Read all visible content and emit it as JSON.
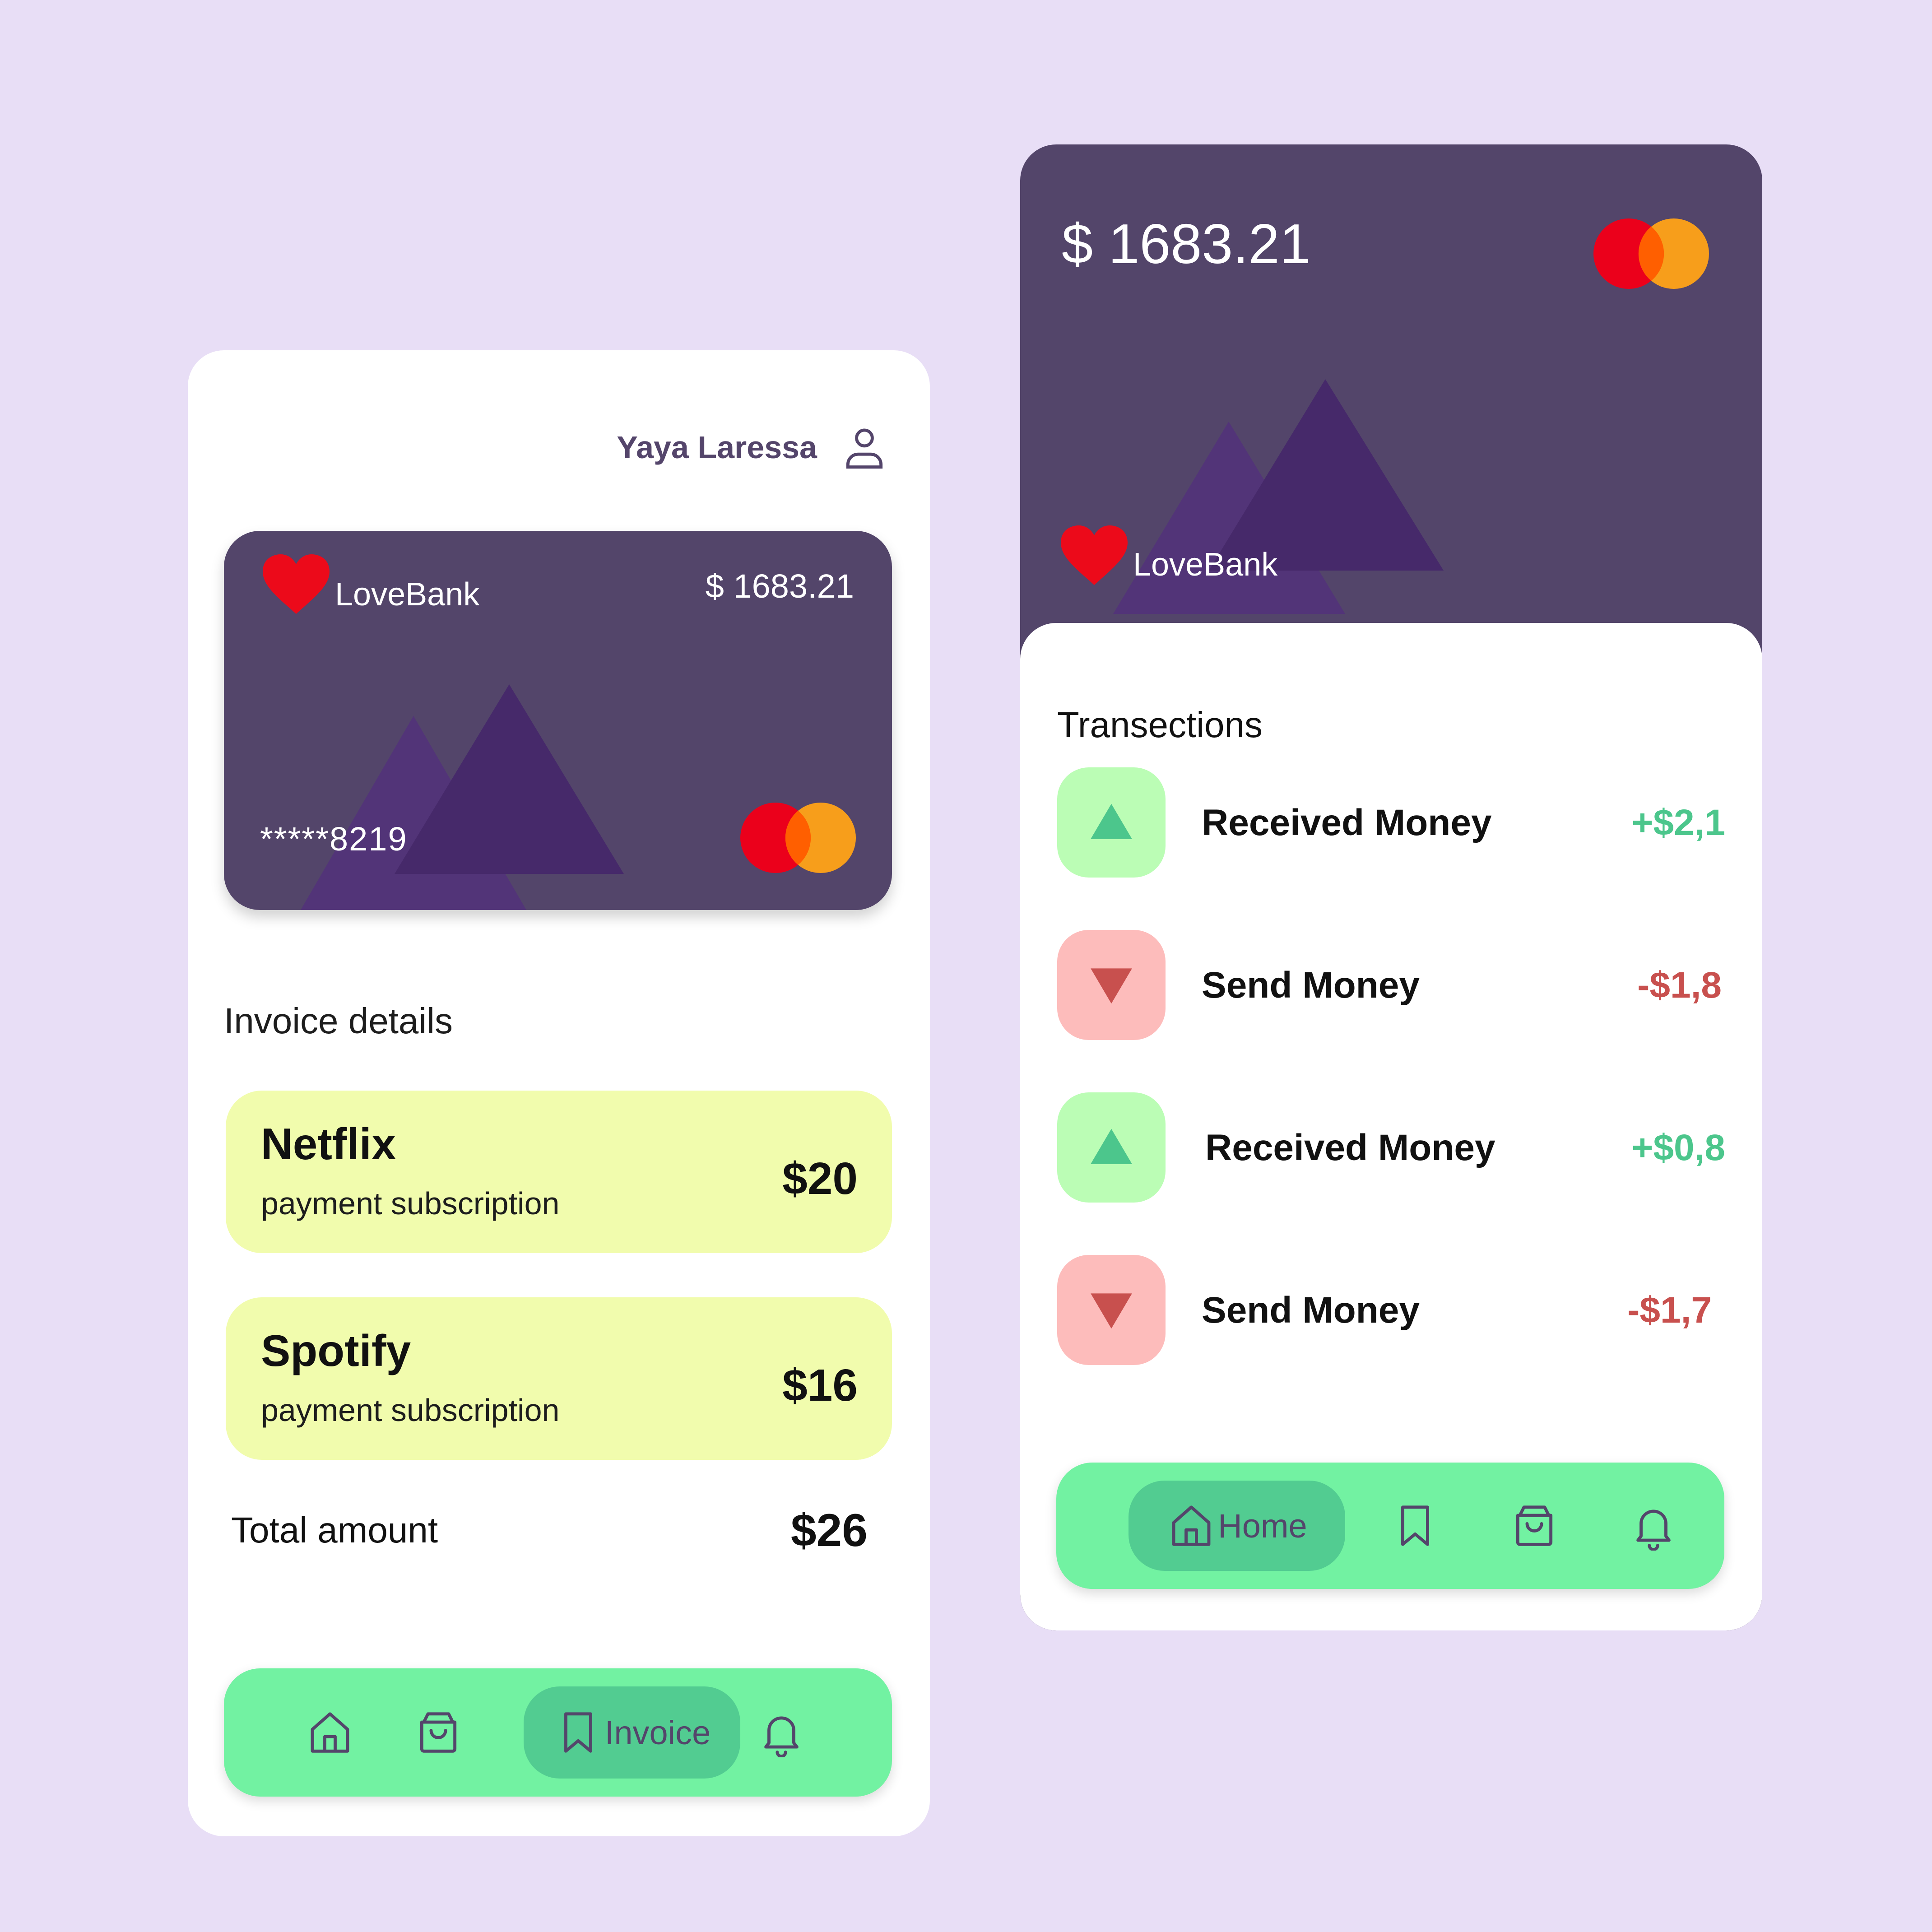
{
  "colors": {
    "background": "#e8def6",
    "card": "#53456a",
    "accent_green": "#72f2a2",
    "active_green": "#52cc91",
    "invoice_bg": "#f1fcad",
    "positive": "#4cc68c",
    "negative": "#c8504e"
  },
  "left": {
    "user_name": "Yaya Laressa",
    "user_icon": "user-icon",
    "card": {
      "brand": "LoveBank",
      "balance": "$ 1683.21",
      "number": "*****8219"
    },
    "invoice_title": "Invoice details",
    "invoices": [
      {
        "name": "Netflix",
        "subtitle": "payment subscription",
        "amount": "$20"
      },
      {
        "name": "Spotify",
        "subtitle": "payment subscription",
        "amount": "$16"
      }
    ],
    "total_label": "Total amount",
    "total_value": "$26",
    "nav": {
      "items": [
        "home-icon",
        "shopping-bag-icon",
        "bookmark-icon",
        "bell-icon"
      ],
      "active_label": "Invoice"
    }
  },
  "right": {
    "balance": "$ 1683.21",
    "brand": "LoveBank",
    "transactions_title": "Transections",
    "transactions": [
      {
        "label": "Received Money",
        "amount": "+$2,1",
        "direction": "up"
      },
      {
        "label": "Send Money",
        "amount": "-$1,8",
        "direction": "down"
      },
      {
        "label": "Received Money",
        "amount": "+$0,8",
        "direction": "up"
      },
      {
        "label": "Send Money",
        "amount": "-$1,7",
        "direction": "down"
      }
    ],
    "nav": {
      "items": [
        "home-icon",
        "bookmark-icon",
        "shopping-bag-icon",
        "bell-icon"
      ],
      "active_label": "Home"
    }
  }
}
